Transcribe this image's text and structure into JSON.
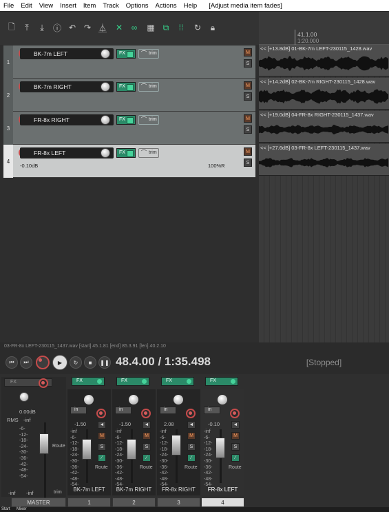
{
  "menu": {
    "items": [
      "File",
      "Edit",
      "View",
      "Insert",
      "Item",
      "Track",
      "Options",
      "Actions",
      "Help"
    ],
    "status_text": "[Adjust media item fades]"
  },
  "toolbar": {
    "icons": [
      "new-project-icon",
      "save-icon",
      "render-icon",
      "info-icon",
      "undo-icon",
      "redo-icon",
      "metronome-icon",
      "ripple-icon",
      "link-icon",
      "grid-icon",
      "snap-icon",
      "grid-lines-icon",
      "loop-icon",
      "lock-icon"
    ]
  },
  "ruler": {
    "position": "41.1.00",
    "time": "1:20.000"
  },
  "tracks": [
    {
      "num": "1",
      "name": "BK-7m LEFT",
      "fx": "FX",
      "trim": "trim",
      "mute": "M",
      "solo": "S",
      "item_label": "<< [+13.8dB] 01-BK-7m LEFT-230115_1428.wav"
    },
    {
      "num": "2",
      "name": "BK-7m RIGHT",
      "fx": "FX",
      "trim": "trim",
      "mute": "M",
      "solo": "S",
      "item_label": "<< [+14.2dB] 02-BK-7m RIGHT-230115_1428.wav"
    },
    {
      "num": "3",
      "name": "FR-8x RIGHT",
      "fx": "FX",
      "trim": "trim",
      "mute": "M",
      "solo": "S",
      "item_label": "<< [+19.0dB] 04-FR-8x RIGHT-230115_1437.wav"
    },
    {
      "num": "4",
      "name": "FR-8x LEFT",
      "fx": "FX",
      "trim": "trim",
      "mute": "M",
      "solo": "S",
      "item_label": "<< [+27.6dB] 03-FR-8x LEFT-230115_1437.wav",
      "volume": "-0.10dB",
      "pan": "100%R"
    }
  ],
  "infobar": "03-FR-8x LEFT-230115_1437.wav [start] 45.1.81 [end] 85.3.91 [len] 40.2.10",
  "transport": {
    "time": "48.4.00 / 1:35.498",
    "status": "[Stopped]"
  },
  "master": {
    "fx": "FX",
    "volume": "0.00dB",
    "rms_label": "RMS",
    "rms_value": "-inf",
    "scale": [
      "-6-",
      "-12-",
      "-18-",
      "-24-",
      "-30-",
      "-36-",
      "-42-",
      "-48-",
      "-54-"
    ],
    "bottom_left": "-inf",
    "bottom_right": "-inf",
    "trim": "trim",
    "route": "Route",
    "name": "MASTER"
  },
  "strips": [
    {
      "fx": "FX",
      "in": "in",
      "volume": "-1.50",
      "mute": "M",
      "solo": "S",
      "route": "Route",
      "name": "BK-7m LEFT",
      "num": "1",
      "scale": [
        "-inf",
        "-6-",
        "-12-",
        "-18-",
        "-24-",
        "-30-",
        "-36-",
        "-42-",
        "-48-",
        "-54-"
      ]
    },
    {
      "fx": "FX",
      "in": "in",
      "volume": "-1.50",
      "mute": "M",
      "solo": "S",
      "route": "Route",
      "name": "BK-7m RIGHT",
      "num": "2",
      "scale": [
        "-inf",
        "-6-",
        "-12-",
        "-18-",
        "-24-",
        "-30-",
        "-36-",
        "-42-",
        "-48-",
        "-54-"
      ]
    },
    {
      "fx": "FX",
      "in": "in",
      "volume": "2.08",
      "mute": "M",
      "solo": "S",
      "route": "Route",
      "name": "FR-8x RIGHT",
      "num": "3",
      "scale": [
        "-inf",
        "-6-",
        "-12-",
        "-18-",
        "-24-",
        "-30-",
        "-36-",
        "-42-",
        "-48-",
        "-54-"
      ]
    },
    {
      "fx": "FX",
      "in": "in",
      "volume": "-0.10",
      "mute": "M",
      "solo": "S",
      "route": "Route",
      "name": "FR-8x LEFT",
      "num": "4",
      "scale": [
        "-inf",
        "-6-",
        "-12-",
        "-18-",
        "-24-",
        "-30-",
        "-36-",
        "-42-",
        "-48-",
        "-54-"
      ]
    }
  ],
  "bottom_tabs": [
    "Start",
    "Mixer"
  ],
  "colors": {
    "accent_green": "#2b8a68",
    "record_red": "#c54b4b",
    "mute_orange": "#ffa060"
  }
}
